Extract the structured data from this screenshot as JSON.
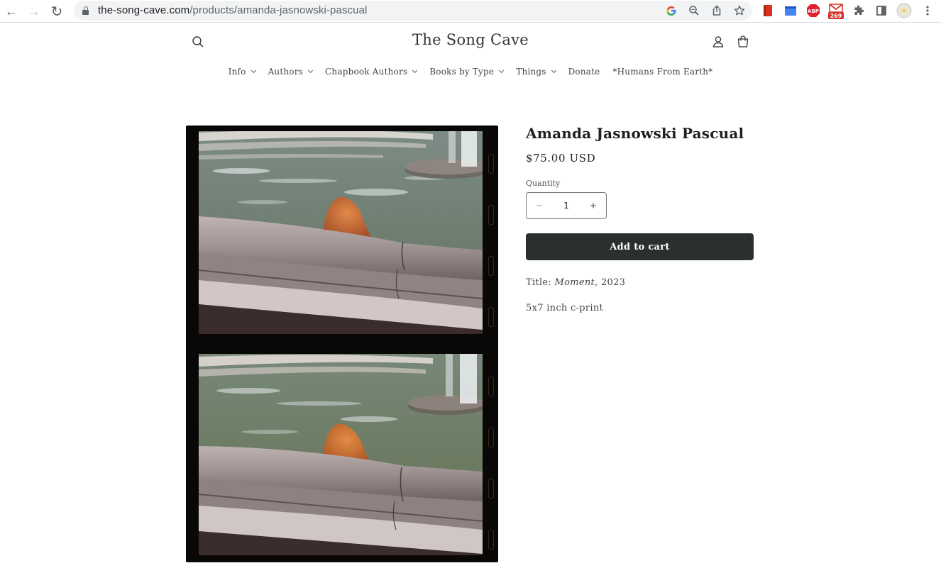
{
  "browser": {
    "url_domain": "the-song-cave.com",
    "url_path": "/products/amanda-jasnowski-pascual",
    "nav": {
      "back": "←",
      "forward": "→",
      "reload": "↻"
    },
    "omnibox_icons": [
      "google-icon",
      "zoom-icon",
      "share-icon",
      "bookmark-star-icon"
    ],
    "extensions": [
      {
        "name": "red-book-extension-icon",
        "color": "#d93025"
      },
      {
        "name": "blue-window-extension-icon",
        "color": "#4285f4"
      },
      {
        "name": "adblock-plus-extension-icon",
        "label": "ABP",
        "color": "#e0222f"
      },
      {
        "name": "gmail-extension-icon",
        "badge": "269",
        "color": "#d93025"
      },
      {
        "name": "extensions-puzzle-icon"
      },
      {
        "name": "side-panel-icon"
      },
      {
        "name": "profile-avatar"
      },
      {
        "name": "browser-menu-icon"
      }
    ]
  },
  "site": {
    "title": "The Song Cave",
    "menu": [
      {
        "label": "Info",
        "dropdown": true
      },
      {
        "label": "Authors",
        "dropdown": true
      },
      {
        "label": "Chapbook Authors",
        "dropdown": true
      },
      {
        "label": "Books by Type",
        "dropdown": true
      },
      {
        "label": "Things",
        "dropdown": true
      },
      {
        "label": "Donate",
        "dropdown": false
      },
      {
        "label": "*Humans From Earth*",
        "dropdown": false
      }
    ]
  },
  "product": {
    "title": "Amanda Jasnowski Pascual",
    "price": "$75.00 USD",
    "quantity_label": "Quantity",
    "quantity_value": "1",
    "minus": "−",
    "plus": "+",
    "add_to_cart": "Add to cart",
    "title_prefix": "Title: ",
    "title_work": "Moment",
    "title_suffix": ", 2023",
    "spec": "5x7 inch c-print"
  }
}
